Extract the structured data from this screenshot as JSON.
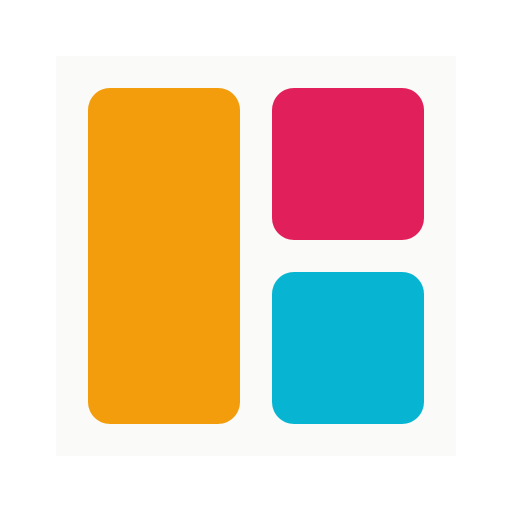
{
  "app_icon": {
    "icon": "collage-layout-icon",
    "colors": {
      "background": "#ffffff",
      "tile": "#fafaf8",
      "tall_block": "#f39c0c",
      "top_block": "#e11f5b",
      "bottom_block": "#07b5d3"
    }
  }
}
